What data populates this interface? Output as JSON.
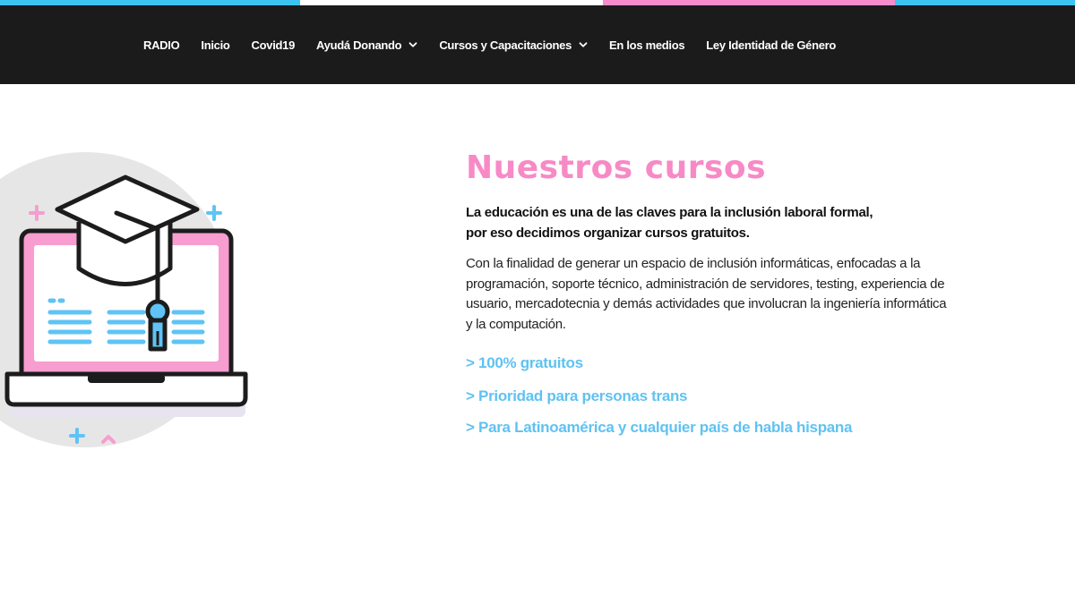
{
  "colors": {
    "cyan": "#3cc5f0",
    "pink": "#f78ccb",
    "title_pink": "#f78ac6",
    "header_bg": "#1b1b1b",
    "feature_blue": "#5fc2f2",
    "light_blue": "#5fc3f5",
    "laptop_pink": "#f79dcf",
    "circle_gray": "#e6e6e6"
  },
  "nav": {
    "items": [
      {
        "label": "RADIO"
      },
      {
        "label": "Inicio"
      },
      {
        "label": "Covid19"
      },
      {
        "label": "Ayudá Donando",
        "has_dropdown": true
      },
      {
        "label": "Cursos y Capacitaciones",
        "has_dropdown": true
      },
      {
        "label": "En los medios"
      },
      {
        "label": "Ley Identidad de Género"
      }
    ]
  },
  "main": {
    "title": "Nuestros cursos",
    "lead_line1": "La educación es una de las claves para la inclusión laboral formal,",
    "lead_line2": "por eso decidimos organizar cursos gratuitos.",
    "body_line1": "Con la finalidad de generar un espacio de inclusión informáticas, enfocadas a la",
    "body_line2": "programación, soporte técnico, administración de servidores, testing, experiencia de",
    "body_line3": "usuario, mercadotecnia y demás actividades que involucran la ingeniería informática",
    "body_line4": "y la computación.",
    "features": [
      "> 100% gratuitos",
      "> Prioridad para personas trans",
      "> Para Latinoamérica y cualquier país de habla hispana"
    ]
  },
  "illustration": {
    "icon": "laptop-graduation-cap-icon"
  }
}
